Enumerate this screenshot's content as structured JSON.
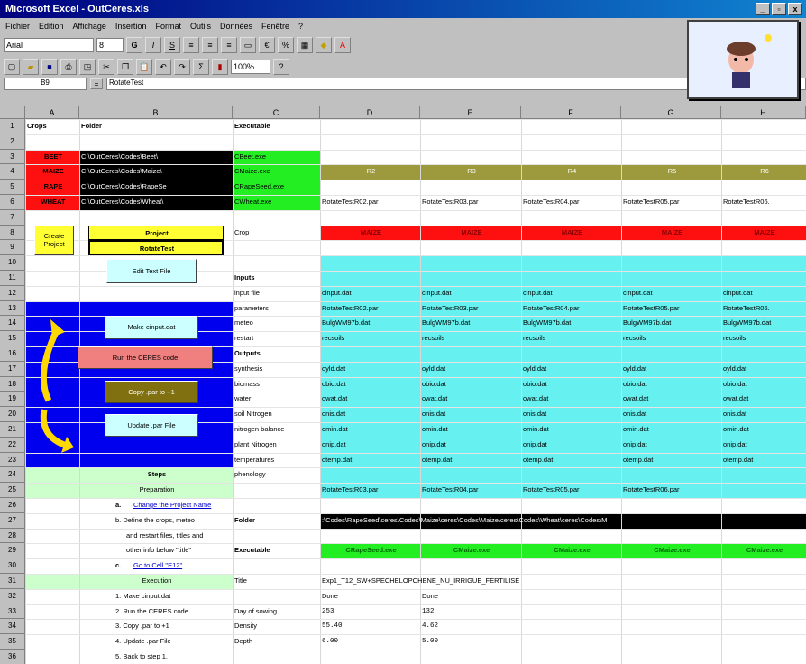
{
  "window": {
    "title": "Microsoft Excel - OutCeres.xls",
    "minimize": "_",
    "restore": "▫",
    "close": "x"
  },
  "menu": [
    "Fichier",
    "Edition",
    "Affichage",
    "Insertion",
    "Format",
    "Outils",
    "Données",
    "Fenêtre",
    "?"
  ],
  "toolbar": {
    "font": "Arial",
    "size": "8"
  },
  "formula": {
    "namebox": "B9",
    "content": "RotateTest"
  },
  "columns": [
    "A",
    "B",
    "C",
    "D",
    "E",
    "F",
    "G",
    "H"
  ],
  "rows": [
    "1",
    "2",
    "3",
    "4",
    "5",
    "6",
    "7",
    "8",
    "9",
    "10",
    "11",
    "12",
    "13",
    "14",
    "15",
    "16",
    "17",
    "18",
    "19",
    "20",
    "21",
    "22",
    "23",
    "24",
    "25",
    "26",
    "27",
    "28",
    "29",
    "30",
    "31",
    "32",
    "33",
    "34",
    "35",
    "36"
  ],
  "header": {
    "crops": "Crops",
    "folder": "Folder",
    "executable": "Executable"
  },
  "crops": [
    {
      "crop": "BEET",
      "folder": "C:\\OutCeres\\Codes\\Beet\\",
      "exe": "CBeet.exe"
    },
    {
      "crop": "MAIZE",
      "folder": "C:\\OutCeres\\Codes\\Maize\\",
      "exe": "CMaize.exe"
    },
    {
      "crop": "RAPE",
      "folder": "C:\\OutCeres\\Codes\\RapeSe",
      "exe": "CRapeSeed.exe"
    },
    {
      "crop": "WHEAT",
      "folder": "C:\\OutCeres\\Codes\\Wheat\\",
      "exe": "CWheat.exe"
    }
  ],
  "codes": [
    "R2",
    "R3",
    "R4",
    "R5",
    "R6"
  ],
  "parfiles": [
    "RotateTestR02.par",
    "RotateTestR03.par",
    "RotateTestR04.par",
    "RotateTestR05.par",
    "RotateTestR06."
  ],
  "project": {
    "create_button": "Create Project",
    "label": "Project",
    "name": "RotateTest",
    "edit_button": "Edit Text File"
  },
  "crop_label": "Crop",
  "crop_row": [
    "MAIZE",
    "MAIZE",
    "MAIZE",
    "MAIZE",
    "MAIZE"
  ],
  "flow": {
    "make": "Make cinput.dat",
    "run": "Run the CERES code",
    "copy": "Copy .par to +1",
    "update": "Update .par File"
  },
  "labels": {
    "inputs": "Inputs",
    "input_file": "input file",
    "parameters": "parameters",
    "meteo": "meteo",
    "restart": "restart",
    "outputs": "Outputs",
    "synthesis": "synthesis",
    "biomass": "biomass",
    "water": "water",
    "soil_nitrogen": "soil Nitrogen",
    "nitrogen_balance": "nitrogen balance",
    "plant_nitrogen": "plant Nitrogen",
    "temperatures": "temperatures",
    "phenology": "phenology",
    "folder": "Folder",
    "executable": "Executable",
    "title": "Title",
    "day_of_sowing": "Day of sowing",
    "density": "Density",
    "depth": "Depth"
  },
  "inputs": {
    "input_file": [
      "cinput.dat",
      "cinput.dat",
      "cinput.dat",
      "cinput.dat",
      "cinput.dat"
    ],
    "parameters": [
      "RotateTestR02.par",
      "RotateTestR03.par",
      "RotateTestR04.par",
      "RotateTestR05.par",
      "RotateTestR06."
    ],
    "meteo": [
      "BulgWM97b.dat",
      "BulgWM97b.dat",
      "BulgWM97b.dat",
      "BulgWM97b.dat",
      "BulgWM97b.dat"
    ],
    "restart": [
      "recsoils",
      "recsoils",
      "recsoils",
      "recsoils",
      "recsoils"
    ]
  },
  "outputs": {
    "synthesis": [
      "oyld.dat",
      "oyld.dat",
      "oyld.dat",
      "oyld.dat",
      "oyld.dat"
    ],
    "biomass": [
      "obio.dat",
      "obio.dat",
      "obio.dat",
      "obio.dat",
      "obio.dat"
    ],
    "water": [
      "owat.dat",
      "owat.dat",
      "owat.dat",
      "owat.dat",
      "owat.dat"
    ],
    "soil_nitrogen": [
      "onis.dat",
      "onis.dat",
      "onis.dat",
      "onis.dat",
      "onis.dat"
    ],
    "nitrogen_balance": [
      "omin.dat",
      "omin.dat",
      "omin.dat",
      "omin.dat",
      "omin.dat"
    ],
    "plant_nitrogen": [
      "onip.dat",
      "onip.dat",
      "onip.dat",
      "onip.dat",
      "onip.dat"
    ],
    "temperatures": [
      "otemp.dat",
      "otemp.dat",
      "otemp.dat",
      "otemp.dat",
      "otemp.dat"
    ]
  },
  "phenology_row": [
    "RotateTestR03.par",
    "RotateTestR04.par",
    "RotateTestR05.par",
    "RotateTestR06.par"
  ],
  "folder_row": ":\\Codes\\RapeSeed\\ceres\\Codes\\Maize\\ceres\\Codes\\Maize\\ceres\\Codes\\Wheat\\ceres\\Codes\\M",
  "exe_row": [
    "CRapeSeed.exe",
    "CMaize.exe",
    "CMaize.exe",
    "CMaize.exe",
    "CMaize.exe"
  ],
  "title_val": "Exp1_T12_SW+SPECHELOPCHENE_NU_IRRIGUE_FERTILISE",
  "title_row2": [
    "Done",
    "Done"
  ],
  "sowing": [
    "253",
    "132"
  ],
  "density": [
    "55.40",
    "4.62"
  ],
  "depth": [
    "6.00",
    "5.00"
  ],
  "steps": {
    "title": "Steps",
    "preparation": "Preparation",
    "a": "a.",
    "a_link": "Change the Project Name",
    "b": "b. Define the crops, meteo",
    "b2": "and restart files, titles and",
    "b3": "other info below \"title\"",
    "c": "c.",
    "c_link": "Go to Cell \"E12\"",
    "execution": "Execution",
    "s1": "1. Make cinput.dat",
    "s2": "2. Run the CERES code",
    "s3": "3. Copy .par to +1",
    "s4": "4. Update .par File",
    "s5": "5. Back to step 1."
  },
  "colors": {
    "red": "#ff1010",
    "green": "#22ee22",
    "olive": "#9c9a3c",
    "cyan": "#66f0f0",
    "blue": "#0000ee",
    "yellow": "#ffff33",
    "lightgreen": "#ccffcc"
  }
}
